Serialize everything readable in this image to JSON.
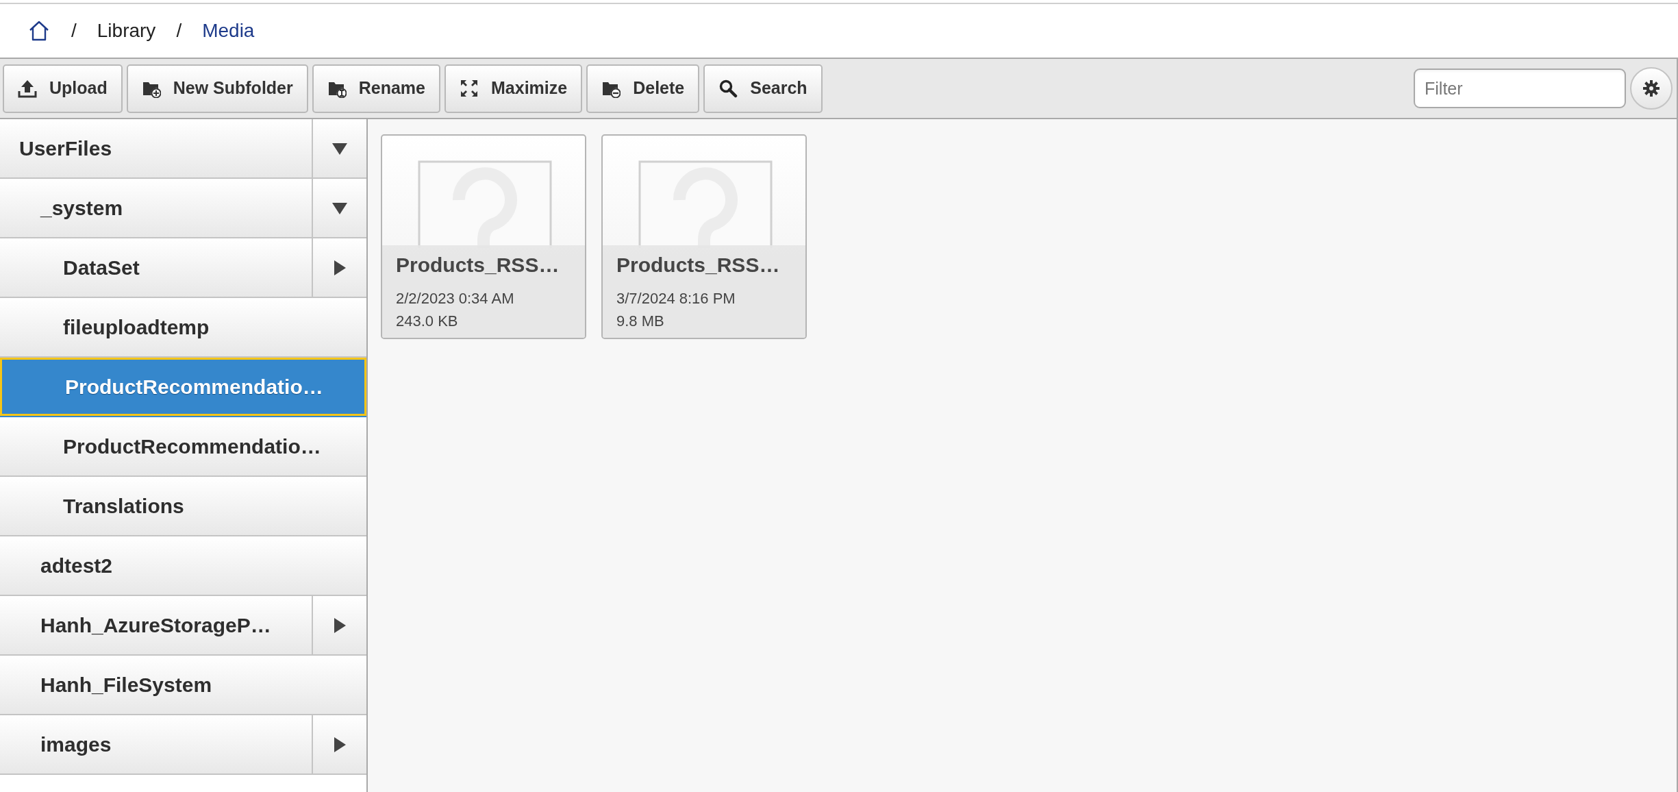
{
  "breadcrumb": [
    {
      "separator": "/",
      "label": "Library",
      "current": false
    },
    {
      "separator": "/",
      "label": "Media",
      "current": true
    }
  ],
  "toolbar": {
    "buttons": [
      {
        "kind": "upload",
        "label": "Upload"
      },
      {
        "kind": "new-folder",
        "label": "New Subfolder"
      },
      {
        "kind": "rename",
        "label": "Rename"
      },
      {
        "kind": "maximize",
        "label": "Maximize"
      },
      {
        "kind": "delete",
        "label": "Delete"
      },
      {
        "kind": "search",
        "label": "Search"
      }
    ],
    "filter": {
      "placeholder": "Filter"
    }
  },
  "tree": [
    {
      "label": "UserFiles",
      "selected": false,
      "expanded": true,
      "children": [
        {
          "label": "_system",
          "selected": false,
          "expanded": true,
          "children": [
            {
              "label": "DataSet",
              "selected": false,
              "expanded": false
            },
            {
              "label": "fileuploadtemp",
              "selected": false
            },
            {
              "label": "ProductRecommendatio…",
              "selected": true
            },
            {
              "label": "ProductRecommendatio…",
              "selected": false
            },
            {
              "label": "Translations",
              "selected": false
            }
          ]
        },
        {
          "label": "adtest2",
          "selected": false
        },
        {
          "label": "Hanh_AzureStorageP…",
          "selected": false,
          "expanded": false
        },
        {
          "label": "Hanh_FileSystem",
          "selected": false
        },
        {
          "label": "images",
          "selected": false,
          "expanded": false
        }
      ]
    }
  ],
  "files": [
    {
      "name": "Products_RSS…",
      "date": "2/2/2023 0:34 AM",
      "size": "243.0 KB"
    },
    {
      "name": "Products_RSS…",
      "date": "3/7/2024 8:16 PM",
      "size": "9.8 MB"
    }
  ]
}
